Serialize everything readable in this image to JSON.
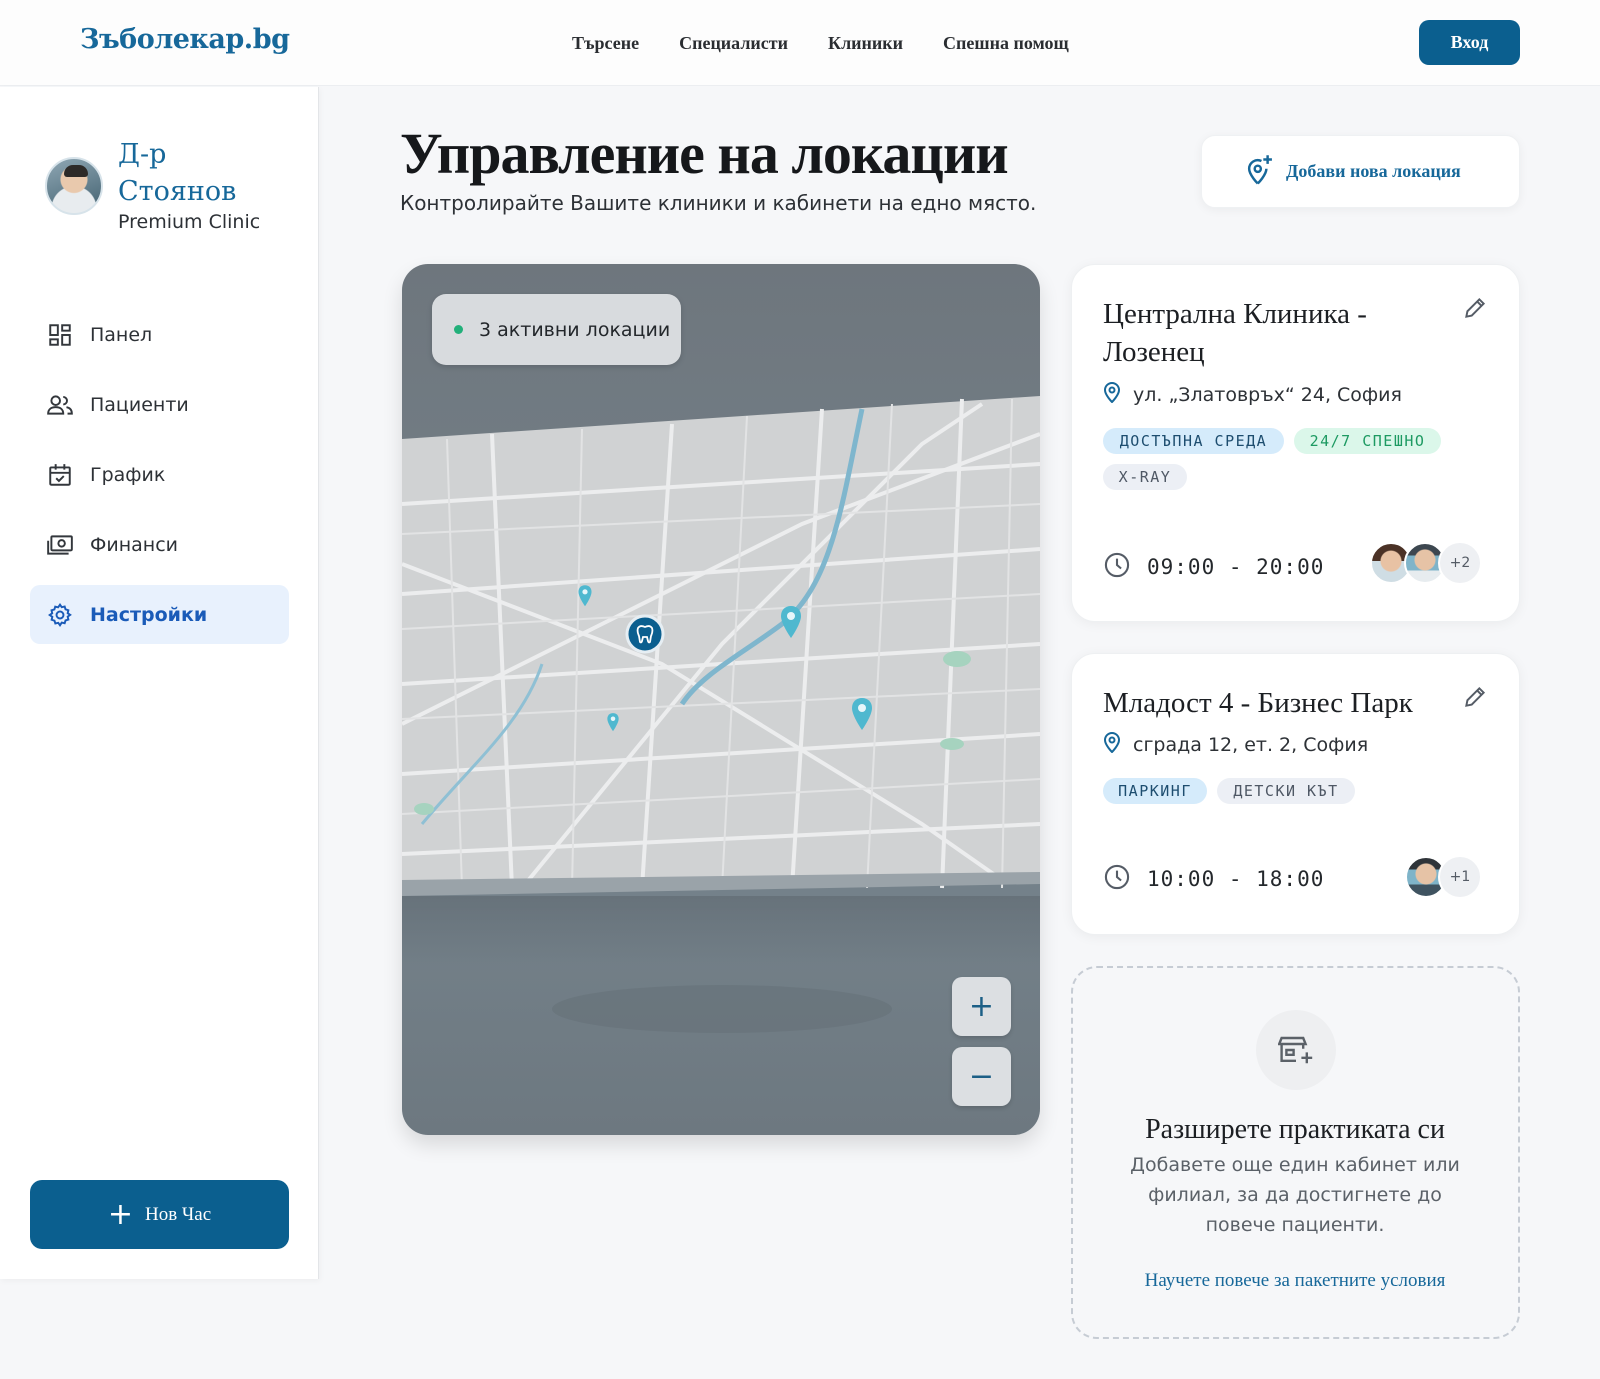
{
  "header": {
    "logo": "Зъболекар.bg",
    "nav": [
      "Търсене",
      "Специалисти",
      "Клиники",
      "Спешна помощ"
    ],
    "login_label": "Вход"
  },
  "sidebar": {
    "doctor_name": "Д-р Стоянов",
    "clinic": "Premium Clinic",
    "items": [
      {
        "label": "Панел",
        "icon": "dashboard-icon"
      },
      {
        "label": "Пациенти",
        "icon": "users-icon"
      },
      {
        "label": "График",
        "icon": "calendar-icon"
      },
      {
        "label": "Финанси",
        "icon": "money-icon"
      },
      {
        "label": "Настройки",
        "icon": "gear-icon",
        "active": true
      }
    ],
    "new_appointment_label": "Нов Час"
  },
  "main": {
    "title": "Управление на локации",
    "subtitle": "Контролирайте Вашите клиники и кабинети на едно място.",
    "add_location_label": "Добави нова локация",
    "map": {
      "badge": "3 активни локации",
      "zoom_in": "+",
      "zoom_out": "−"
    },
    "locations": [
      {
        "name": "Централна Клиника - Лозенец",
        "address": "ул. „Златовръх“ 24, София",
        "tags": [
          "ДОСТЪПНА СРЕДА",
          "24/7 СПЕШНО",
          "X-RAY"
        ],
        "hours": "09:00 - 20:00",
        "staff_more": "+2"
      },
      {
        "name": "Младост 4 - Бизнес Парк",
        "address": "сграда 12, ет. 2, София",
        "tags": [
          "ПАРКИНГ",
          "ДЕТСКИ КЪТ"
        ],
        "hours": "10:00 - 18:00",
        "staff_more": "+1"
      }
    ],
    "expand": {
      "title": "Разширете практиката си",
      "description": "Добавете още един кабинет или филиал, за да достигнете до повече пациенти.",
      "link": "Научете повече за пакетните условия"
    }
  },
  "colors": {
    "primary": "#0b5f8f",
    "accent_blue": "#17689a",
    "active_bg": "#e8f1fd",
    "active_text": "#1a5bb8",
    "status_green": "#22b07a"
  }
}
